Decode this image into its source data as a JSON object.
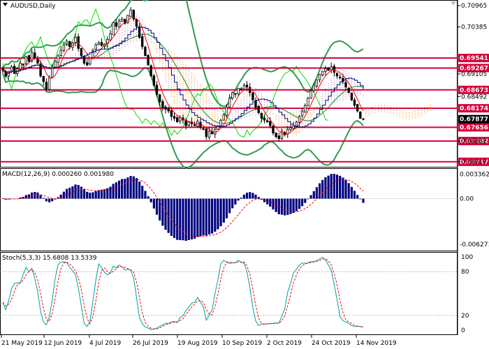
{
  "chart_data": [
    {
      "type": "candlestick",
      "panel": "price",
      "title": "AUDUSD,Daily",
      "y_ticks": [
        "0.70965",
        "0.70385",
        "0.69105",
        "0.68492",
        "0.67282",
        "0.66717"
      ],
      "ylim": [
        0.666,
        0.7108
      ],
      "grid": false,
      "horizontal_levels": [
        {
          "label": "0.69541",
          "value": 0.69541
        },
        {
          "label": "0.69267",
          "value": 0.69267
        },
        {
          "label": "0.68673",
          "value": 0.68673
        },
        {
          "label": "0.68174",
          "value": 0.68174
        },
        {
          "label": "0.67656",
          "value": 0.67656
        },
        {
          "label": "0.67282",
          "value": 0.67282
        },
        {
          "label": "0.66717",
          "value": 0.66717
        }
      ],
      "current_price": {
        "label": "0.67877",
        "value": 0.67877
      },
      "x_ticks": [
        "21 May 2019",
        "12 Jun 2019",
        "4 Jul 2019",
        "26 Jul 2019",
        "19 Aug 2019",
        "10 Sep 2019",
        "2 Oct 2019",
        "24 Oct 2019",
        "14 Nov 2019"
      ],
      "close_series": [
        0.692,
        0.6905,
        0.6918,
        0.693,
        0.6912,
        0.6925,
        0.694,
        0.6935,
        0.6958,
        0.6945,
        0.697,
        0.6955,
        0.694,
        0.6905,
        0.689,
        0.687,
        0.69,
        0.693,
        0.6945,
        0.696,
        0.6975,
        0.699,
        0.7,
        0.6985,
        0.6995,
        0.701,
        0.698,
        0.696,
        0.694,
        0.6935,
        0.6955,
        0.6975,
        0.699,
        0.6995,
        0.6988,
        0.6992,
        0.7005,
        0.702,
        0.705,
        0.704,
        0.7055,
        0.706,
        0.7048,
        0.707,
        0.7085,
        0.706,
        0.704,
        0.701,
        0.6985,
        0.696,
        0.6935,
        0.6905,
        0.688,
        0.6855,
        0.6835,
        0.682,
        0.6815,
        0.681,
        0.6795,
        0.679,
        0.678,
        0.6792,
        0.6785,
        0.677,
        0.678,
        0.6775,
        0.677,
        0.6782,
        0.6765,
        0.676,
        0.674,
        0.6755,
        0.6748,
        0.676,
        0.677,
        0.6785,
        0.68,
        0.682,
        0.6845,
        0.686,
        0.6855,
        0.6872,
        0.6868,
        0.688,
        0.6875,
        0.686,
        0.684,
        0.682,
        0.6805,
        0.679,
        0.6785,
        0.678,
        0.677,
        0.675,
        0.674,
        0.6735,
        0.6755,
        0.6745,
        0.676,
        0.6765,
        0.677,
        0.678,
        0.6795,
        0.681,
        0.6825,
        0.6845,
        0.6865,
        0.688,
        0.6895,
        0.691,
        0.6918,
        0.6925,
        0.692,
        0.693,
        0.6915,
        0.6905,
        0.69,
        0.689,
        0.6875,
        0.686,
        0.684,
        0.6825,
        0.681,
        0.679,
        0.6788
      ],
      "indicators": [
        "Bollinger Bands",
        "Ichimoku Cloud",
        "Moving averages"
      ]
    },
    {
      "type": "bar",
      "panel": "macd",
      "title": "MACD(12,26,9) 0.000260 0.001980",
      "y_ticks": [
        "0.003362",
        "0.00",
        "-0.006271"
      ],
      "ylim": [
        -0.00705,
        0.004
      ],
      "signal_style": "dashed red line"
    },
    {
      "type": "line",
      "panel": "stochastic",
      "title": "Stoch(5,3,3) 15.6808 13.5339",
      "y_ticks": [
        "100",
        "80",
        "20",
        "0"
      ],
      "ylim": [
        -5,
        105
      ],
      "reference_levels": [
        80,
        20
      ],
      "series": [
        {
          "color": "#00a0a0"
        },
        {
          "color": "#ff0000",
          "style": "dashed"
        }
      ]
    }
  ],
  "colors": {
    "candle": "#000000",
    "level_line": "#d6003a",
    "price_tag_bg": "#000000",
    "bollinger": "#2e9c4e",
    "ma_red": "#ff0000",
    "ma_blue": "#000080",
    "lime_line": "#00e000",
    "cloud_pink": "#c07ab7",
    "cloud_orange": "#ff8c1a",
    "macd_hist": "#000080",
    "macd_signal": "#ff0000",
    "stoch_main": "#00a0a0",
    "stoch_signal": "#ff0000"
  }
}
